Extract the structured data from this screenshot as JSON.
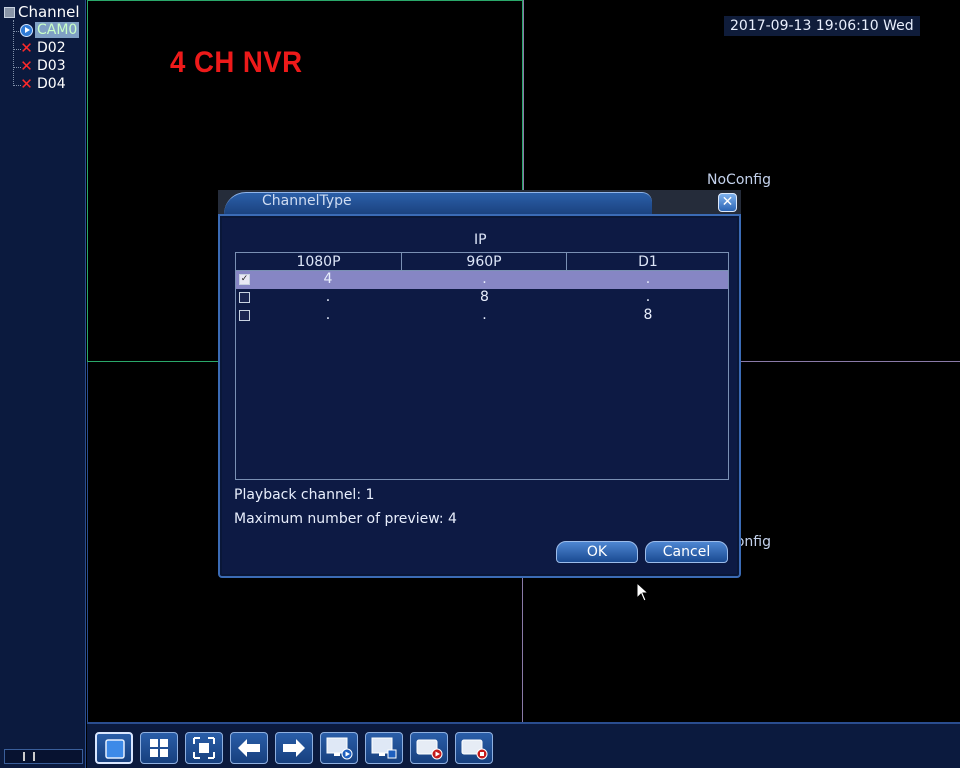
{
  "sidebar": {
    "title": "Channel",
    "channels": [
      {
        "label": "CAM0",
        "status": "play-icon",
        "selected": true
      },
      {
        "label": "D02",
        "status": "x-icon",
        "selected": false
      },
      {
        "label": "D03",
        "status": "x-icon",
        "selected": false
      },
      {
        "label": "D04",
        "status": "x-icon",
        "selected": false
      }
    ]
  },
  "overlay": {
    "brand": "4 CH NVR",
    "clock": "2017-09-13 19:06:10 Wed",
    "noconfig_top": "NoConfig",
    "noconfig_bottom": "NoConfig"
  },
  "dialog": {
    "title": "ChannelType",
    "group_label": "IP",
    "columns": [
      "1080P",
      "960P",
      "D1"
    ],
    "rows": [
      {
        "checked": true,
        "cells": [
          "4",
          ".",
          "."
        ]
      },
      {
        "checked": false,
        "cells": [
          ".",
          "8",
          "."
        ]
      },
      {
        "checked": false,
        "cells": [
          ".",
          ".",
          "8"
        ]
      }
    ],
    "playback_channel": "Playback channel: 1",
    "max_preview": "Maximum number of preview: 4",
    "ok_label": "OK",
    "cancel_label": "Cancel"
  },
  "toolbar": {
    "buttons": [
      "single-view-icon",
      "quad-view-icon",
      "fullscreen-icon",
      "prev-icon",
      "next-icon",
      "playback-icon",
      "monitor-icon",
      "record-icon",
      "stop-record-icon"
    ]
  },
  "colors": {
    "brand_red": "#ee1a1a",
    "panel_blue": "#0d1a44",
    "accent_blue": "#2b5fa8",
    "selected_row": "#8686c4"
  }
}
